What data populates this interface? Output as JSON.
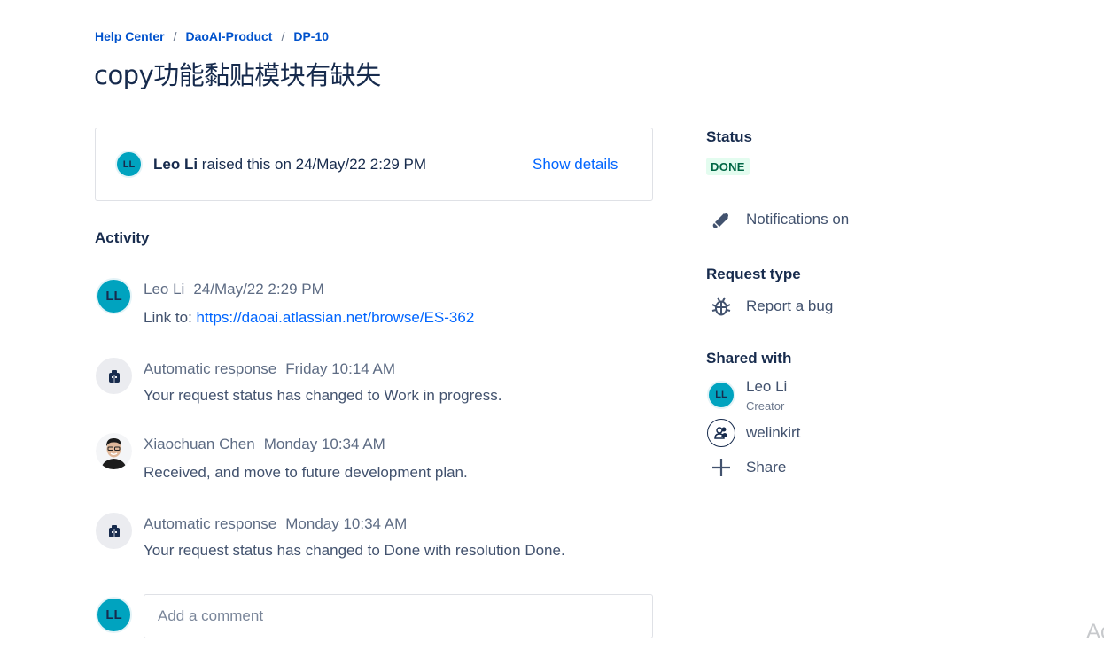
{
  "breadcrumb": {
    "items": [
      "Help Center",
      "DaoAI-Product",
      "DP-10"
    ],
    "separator": "/"
  },
  "title": "copy功能黏贴模块有缺失",
  "raised": {
    "avatar_initials": "LL",
    "name": "Leo Li",
    "text": "raised this on 24/May/22 2:29 PM",
    "show_details_label": "Show details"
  },
  "activity": {
    "heading": "Activity",
    "entries": [
      {
        "avatar": "LL",
        "author": "Leo Li",
        "time": "24/May/22 2:29 PM",
        "body_prefix": "Link to: ",
        "body_link": "https://daoai.atlassian.net/browse/ES-362"
      },
      {
        "avatar": "robot-icon",
        "author": "Automatic response",
        "time": "Friday 10:14 AM",
        "body": "Your request status has changed to Work in progress."
      },
      {
        "avatar": "user-photo",
        "author": "Xiaochuan Chen",
        "time": "Monday 10:34 AM",
        "body": "Received, and move to future development plan."
      },
      {
        "avatar": "robot-icon",
        "author": "Automatic response",
        "time": "Monday 10:34 AM",
        "body": "Your request status has changed to Done with resolution Done."
      }
    ]
  },
  "comment": {
    "avatar_initials": "LL",
    "placeholder": "Add a comment"
  },
  "sidebar": {
    "status_heading": "Status",
    "status_value": "DONE",
    "notifications_label": "Notifications on",
    "request_type_heading": "Request type",
    "request_type_value": "Report a bug",
    "shared_heading": "Shared with",
    "shared": [
      {
        "avatar_initials": "LL",
        "name": "Leo Li",
        "role": "Creator"
      },
      {
        "avatar": "people-icon",
        "name": "welinkirt"
      }
    ],
    "share_label": "Share"
  },
  "corner_text": "Ac",
  "colors": {
    "link": "#0052cc",
    "avatar": "#00a3bf",
    "done_bg": "#e3fcef",
    "done_text": "#006644"
  }
}
